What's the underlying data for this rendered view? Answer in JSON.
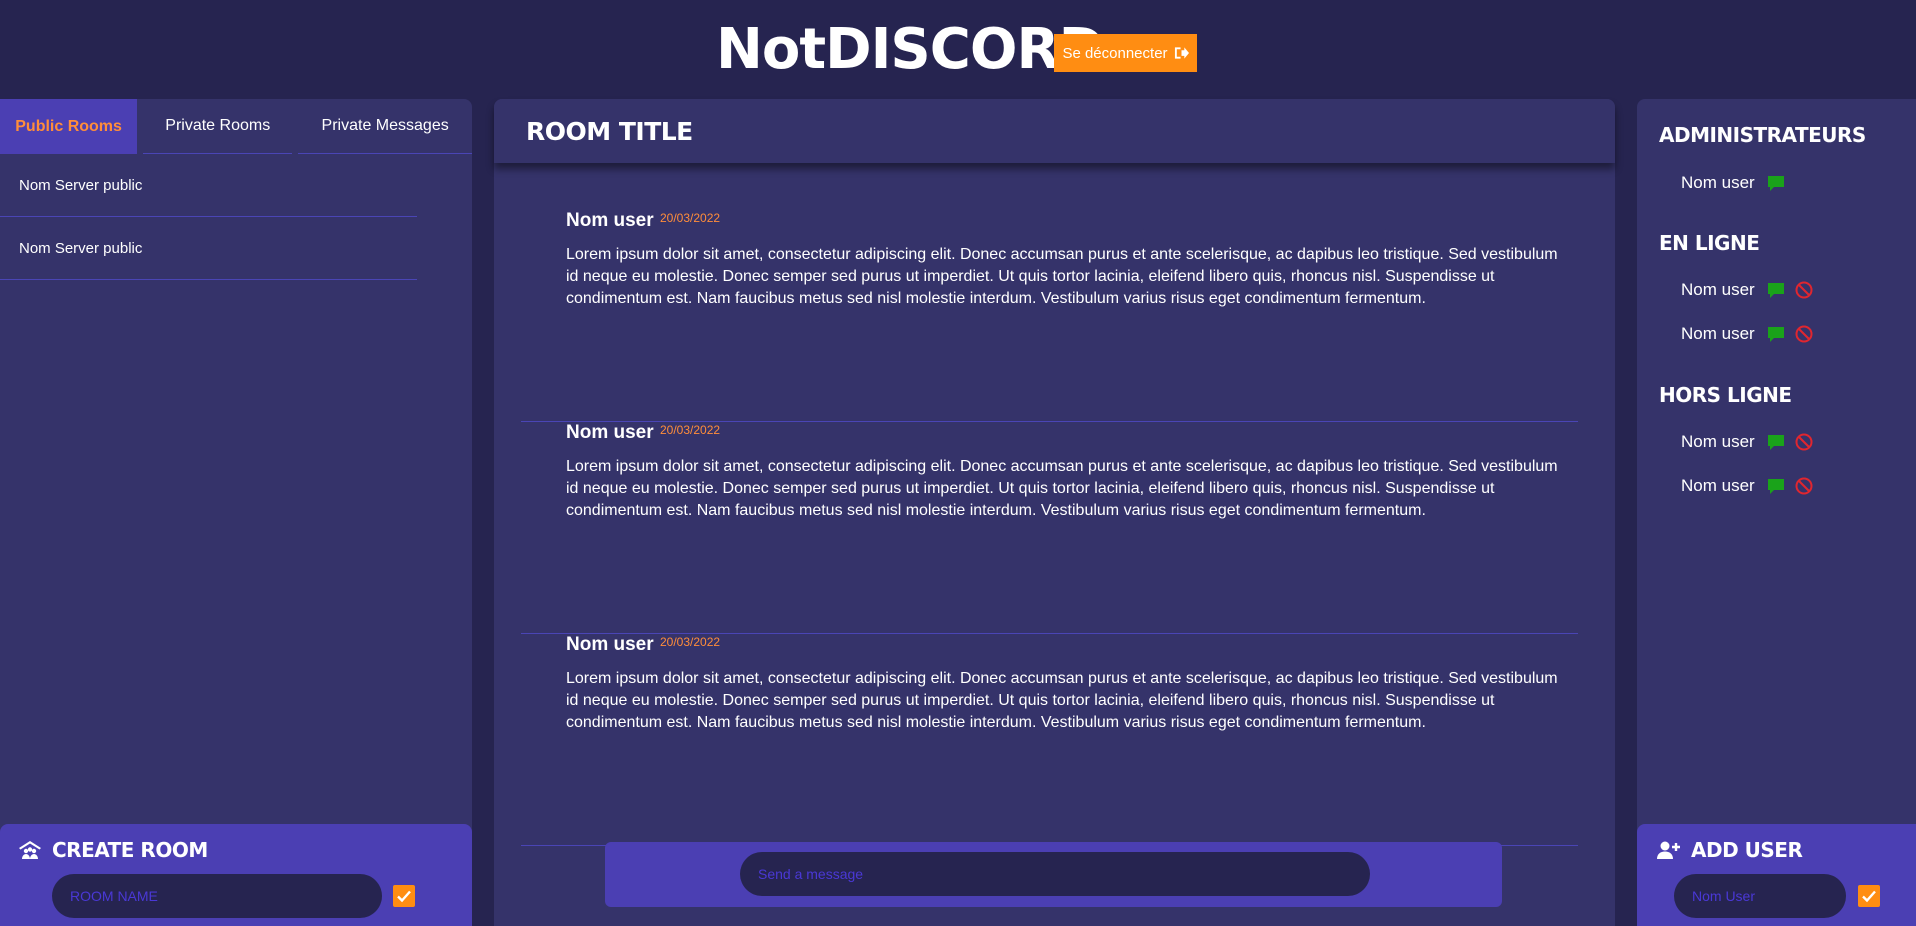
{
  "header": {
    "logo": "NotDISCORD",
    "logout_label": "Se déconnecter"
  },
  "left": {
    "tabs": [
      {
        "label": "Public Rooms",
        "active": true
      },
      {
        "label": "Private Rooms",
        "active": false
      },
      {
        "label": "Private Messages",
        "active": false
      }
    ],
    "rooms": [
      "Nom Server public",
      "Nom Server public"
    ],
    "create_room": {
      "title": "CREATE ROOM",
      "placeholder": "ROOM NAME"
    }
  },
  "center": {
    "room_title": "ROOM TITLE",
    "messages": [
      {
        "user": "Nom user",
        "date": "20/03/2022",
        "text": "Lorem ipsum dolor sit amet, consectetur adipiscing elit. Donec accumsan purus et ante scelerisque, ac dapibus leo tristique. Sed vestibulum id neque eu molestie. Donec semper sed purus ut imperdiet. Ut quis tortor lacinia, eleifend libero quis, rhoncus nisl. Suspendisse ut condimentum est. Nam faucibus metus sed nisl molestie interdum. Vestibulum varius risus eget condimentum fermentum."
      },
      {
        "user": "Nom user",
        "date": "20/03/2022",
        "text": "Lorem ipsum dolor sit amet, consectetur adipiscing elit. Donec accumsan purus et ante scelerisque, ac dapibus leo tristique. Sed vestibulum id neque eu molestie. Donec semper sed purus ut imperdiet. Ut quis tortor lacinia, eleifend libero quis, rhoncus nisl. Suspendisse ut condimentum est. Nam faucibus metus sed nisl molestie interdum. Vestibulum varius risus eget condimentum fermentum."
      },
      {
        "user": "Nom user",
        "date": "20/03/2022",
        "text": "Lorem ipsum dolor sit amet, consectetur adipiscing elit. Donec accumsan purus et ante scelerisque, ac dapibus leo tristique. Sed vestibulum id neque eu molestie. Donec semper sed purus ut imperdiet. Ut quis tortor lacinia, eleifend libero quis, rhoncus nisl. Suspendisse ut condimentum est. Nam faucibus metus sed nisl molestie interdum. Vestibulum varius risus eget condimentum fermentum."
      }
    ],
    "composer": {
      "placeholder": "Send a message"
    }
  },
  "right": {
    "sections": [
      {
        "title": "ADMINISTRATEURS",
        "users": [
          {
            "name": "Nom user",
            "icons": [
              "chat-icon"
            ]
          }
        ]
      },
      {
        "title": "EN LIGNE",
        "users": [
          {
            "name": "Nom user",
            "icons": [
              "chat-icon",
              "ban-icon"
            ]
          },
          {
            "name": "Nom user",
            "icons": [
              "chat-icon",
              "ban-icon"
            ]
          }
        ]
      },
      {
        "title": "HORS LIGNE",
        "users": [
          {
            "name": "Nom user",
            "icons": [
              "chat-icon",
              "ban-icon"
            ]
          },
          {
            "name": "Nom user",
            "icons": [
              "chat-icon",
              "ban-icon"
            ]
          }
        ]
      }
    ],
    "add_user": {
      "title": "ADD USER",
      "placeholder": "Nom User"
    }
  },
  "colors": {
    "background": "#262450",
    "panel": "#35336a",
    "accent_purple": "#4b3fb3",
    "accent_orange": "#ff8d12",
    "chat_green": "#1aa31a",
    "ban_red": "#e0262f"
  }
}
